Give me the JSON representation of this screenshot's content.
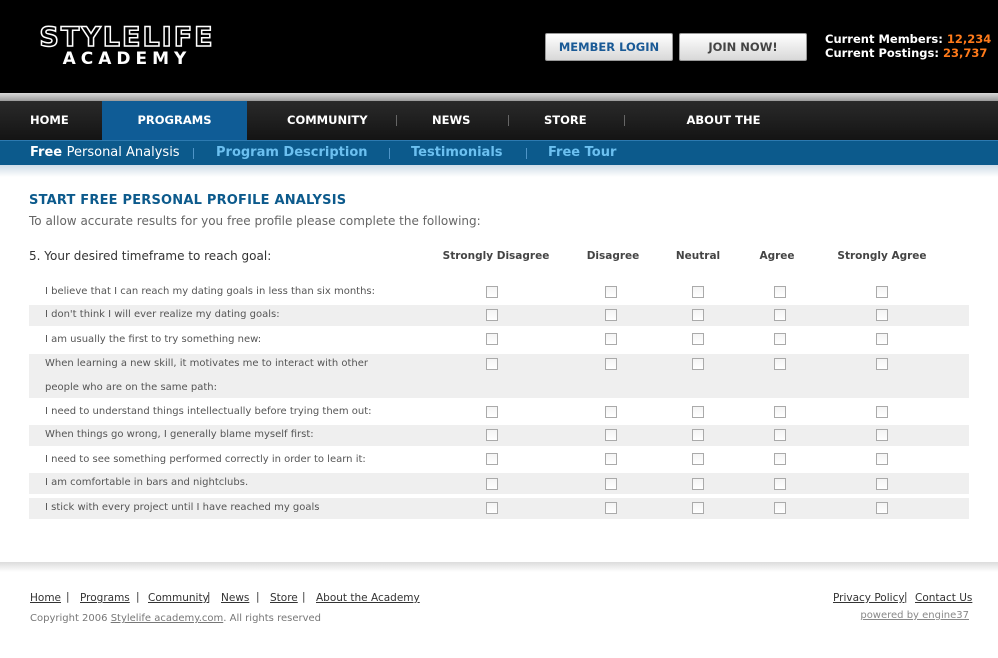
{
  "header": {
    "logo_line1": "STYLELIFE",
    "logo_line2": "ACADEMY",
    "login_label": "MEMBER  LOGIN",
    "join_label": "JOIN NOW!",
    "members_label": "Current Members:",
    "members_value": "12,234",
    "postings_label": "Current Postings:",
    "postings_value": "23,737"
  },
  "nav": {
    "items": [
      {
        "label": "HOME"
      },
      {
        "label": "PROGRAMS"
      },
      {
        "label": "COMMUNITY"
      },
      {
        "label": "NEWS"
      },
      {
        "label": "STORE"
      },
      {
        "label": "ABOUT THE ACADEMY"
      }
    ],
    "active": "PROGRAMS"
  },
  "subnav": {
    "items": [
      {
        "bold": "Free",
        "light": "Personal Analysis"
      },
      {
        "label": "Program Description"
      },
      {
        "label": "Testimonials"
      },
      {
        "label": "Free Tour"
      }
    ]
  },
  "main": {
    "title": "START FREE PERSONAL PROFILE ANALYSIS",
    "subtitle": "To allow accurate results for you free profile please complete the following:",
    "question": "5. Your desired timeframe to reach goal:",
    "columns": [
      "Strongly Disagree",
      "Disagree",
      "Neutral",
      "Agree",
      "Strongly Agree"
    ],
    "statements": [
      "I believe that I can reach my dating goals in less than six months:",
      "I don't think I will ever realize my dating goals:",
      "I am usually the first to try something new:",
      "When learning a new skill, it motivates me to interact with other",
      "people who are on the same path:",
      "I need to understand things intellectually before trying them out:",
      "When things go wrong, I generally blame myself first:",
      "I need to see something performed correctly in order to learn it:",
      "I am comfortable in bars and nightclubs.",
      "I stick with every project until I have reached my goals"
    ]
  },
  "footer": {
    "links": [
      "Home",
      "Programs",
      "Community",
      "News",
      "Store",
      "About the Academy"
    ],
    "privacy": "Privacy Policy",
    "contact": "Contact Us",
    "copyright_prefix": "Copyright 2006",
    "copyright_link": "Stylelife academy.com",
    "copyright_suffix": ".  All rights reserved",
    "powered": "powered by engine37"
  }
}
